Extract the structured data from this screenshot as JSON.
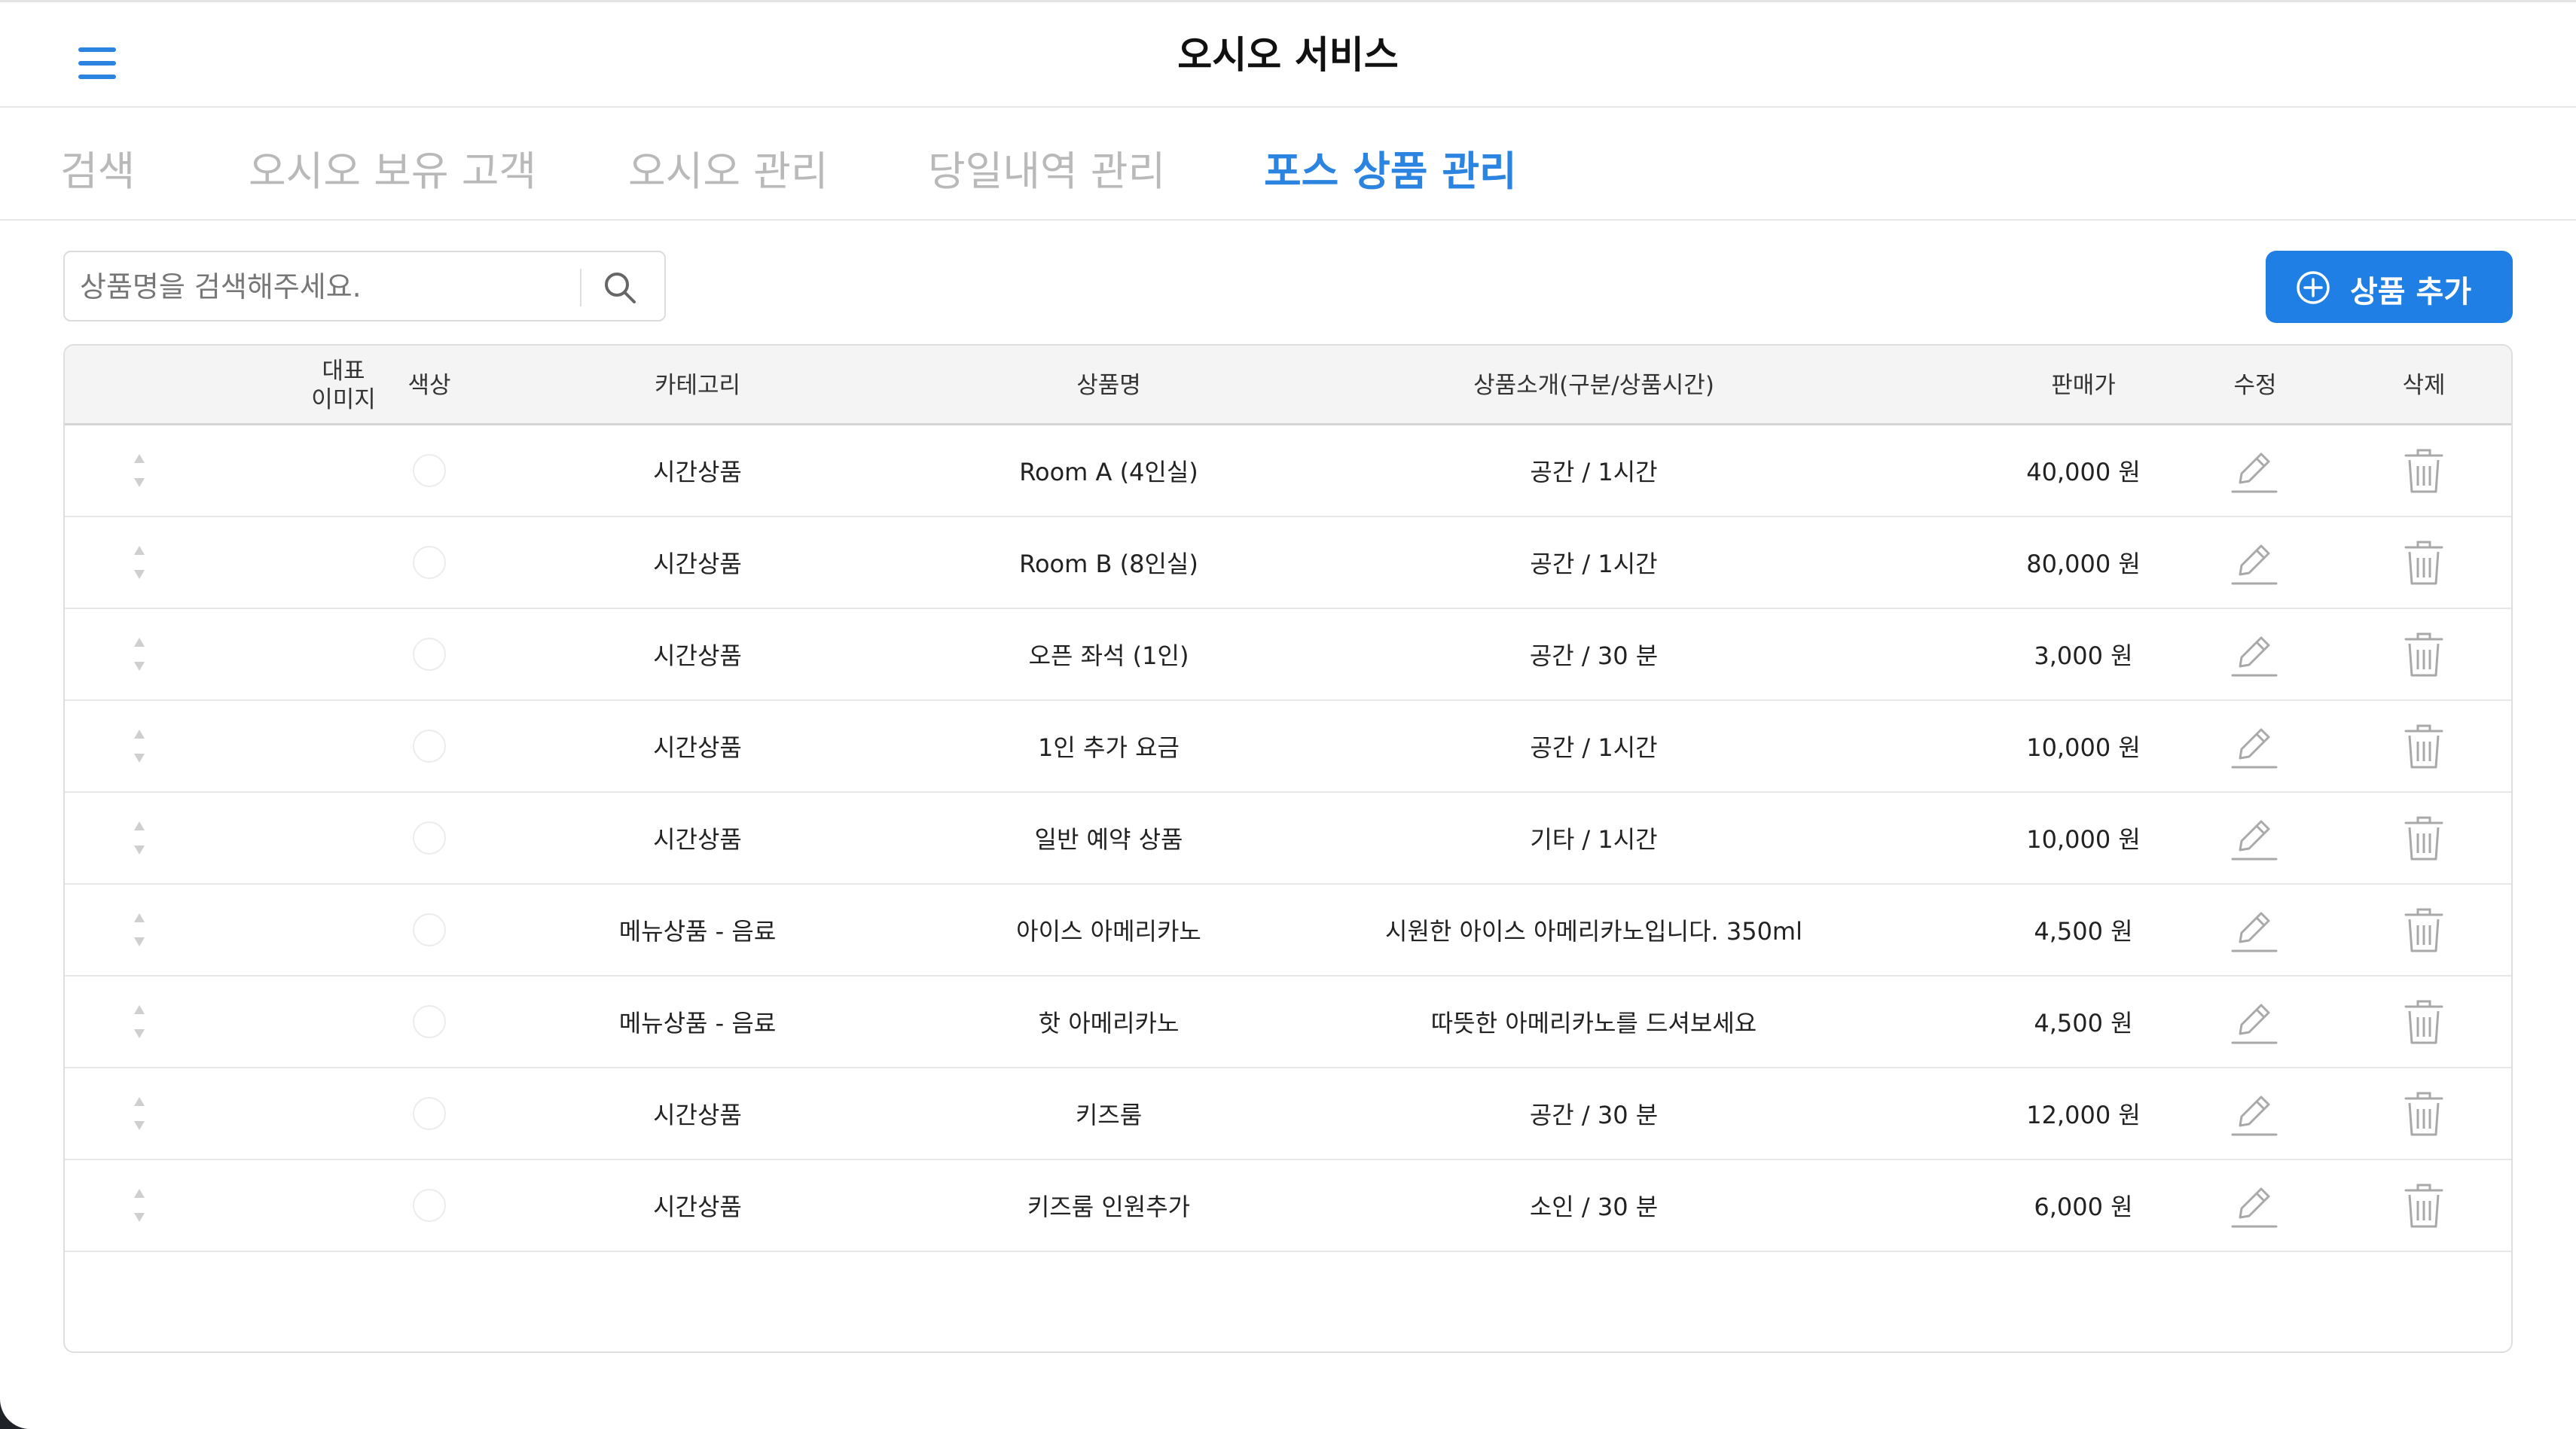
{
  "header": {
    "title": "오시오 서비스"
  },
  "tabs": [
    {
      "label": "검색"
    },
    {
      "label": "오시오 보유 고객"
    },
    {
      "label": "오시오 관리"
    },
    {
      "label": "당일내역 관리"
    },
    {
      "label": "포스 상품 관리"
    }
  ],
  "search": {
    "placeholder": "상품명을 검색해주세요.",
    "value": ""
  },
  "add_button": {
    "label": "상품 추가"
  },
  "colors": {
    "accent": "#1f7fe5",
    "tab_active": "#2a84e0",
    "tab_inactive": "#b9b9b9"
  },
  "table": {
    "headers": {
      "image": "대표\n이미지",
      "color": "색상",
      "category": "카테고리",
      "name": "상품명",
      "intro": "상품소개(구분/상품시간)",
      "price": "판매가",
      "edit": "수정",
      "delete": "삭제"
    },
    "rows": [
      {
        "category": "시간상품",
        "name": "Room A (4인실)",
        "intro": "공간 / 1시간",
        "price": "40,000 원"
      },
      {
        "category": "시간상품",
        "name": "Room B (8인실)",
        "intro": "공간 / 1시간",
        "price": "80,000 원"
      },
      {
        "category": "시간상품",
        "name": "오픈 좌석 (1인)",
        "intro": "공간 / 30 분",
        "price": "3,000 원"
      },
      {
        "category": "시간상품",
        "name": "1인 추가 요금",
        "intro": "공간 / 1시간",
        "price": "10,000 원"
      },
      {
        "category": "시간상품",
        "name": "일반 예약 상품",
        "intro": "기타 / 1시간",
        "price": "10,000 원"
      },
      {
        "category": "메뉴상품 - 음료",
        "name": "아이스 아메리카노",
        "intro": "시원한 아이스 아메리카노입니다. 350ml",
        "price": "4,500 원"
      },
      {
        "category": "메뉴상품 - 음료",
        "name": "핫 아메리카노",
        "intro": "따뜻한 아메리카노를 드셔보세요",
        "price": "4,500 원"
      },
      {
        "category": "시간상품",
        "name": "키즈룸",
        "intro": "공간 / 30 분",
        "price": "12,000 원"
      },
      {
        "category": "시간상품",
        "name": "키즈룸 인원추가",
        "intro": "소인 / 30 분",
        "price": "6,000 원"
      }
    ]
  }
}
